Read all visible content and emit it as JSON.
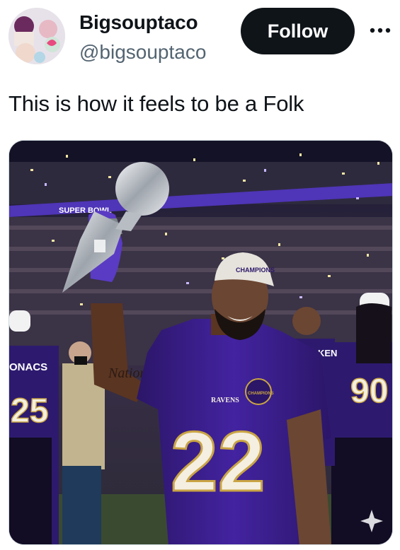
{
  "author": {
    "name": "Bigsouptaco",
    "handle": "@bigsouptaco"
  },
  "follow_label": "Follow",
  "more_icon": "more-horizontal-icon",
  "tweet": {
    "text": "This is how it feels to be a Folk"
  },
  "media": {
    "ribbon_text": "SUPER BOWL",
    "cap_text": "CHAMPIONS",
    "player_number": "22",
    "jersey_wordmark": "RAVENS",
    "patch_text": "CHAMPIONS",
    "left_player_name": "ONACS",
    "left_player_number": "25",
    "right_player_number": "90",
    "right_player_name": "KEN",
    "tattoo_text": "Nation",
    "colors": {
      "jersey": "#3c1f8c",
      "jersey_shadow": "#26135c",
      "number_fill": "#f4efe0",
      "number_outline": "#c9a444",
      "trophy": "#c8ccd2",
      "crowd": "#2a2238"
    }
  }
}
